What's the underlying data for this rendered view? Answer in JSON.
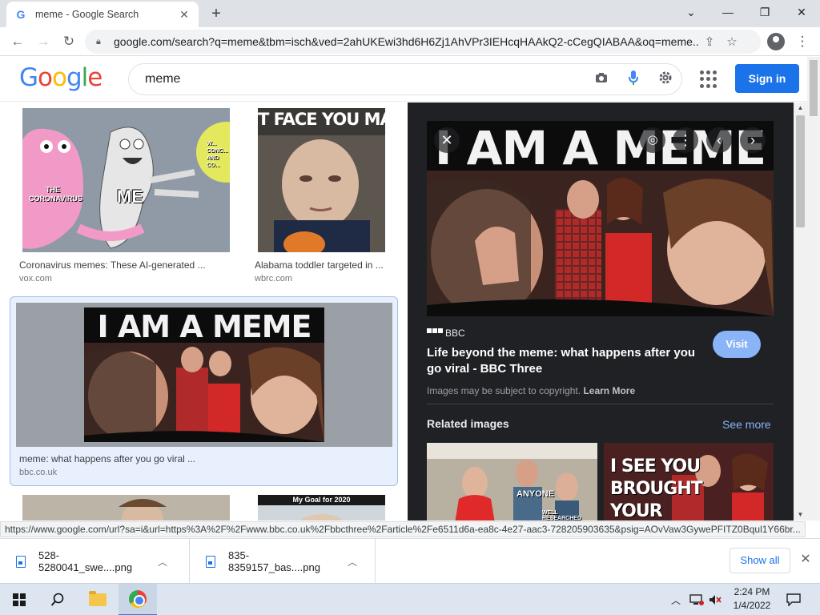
{
  "browser": {
    "tab_title": "meme - Google Search",
    "tab_favicon": "G",
    "url": "google.com/search?q=meme&tbm=isch&ved=2ahUKEwi3hd6H6Zj1AhVPr3IEHcqHAAkQ2-cCegQIABAA&oq=meme...",
    "status_url": "https://www.google.com/url?sa=i&url=https%3A%2F%2Fwww.bbc.co.uk%2Fbbcthree%2Farticle%2Fe6511d6a-ea8c-4e27-aac3-728205903635&psig=AOvVaw3GywePFITZ0Bqul1Y66br..."
  },
  "google": {
    "logo_letters": [
      "G",
      "o",
      "o",
      "g",
      "l",
      "e"
    ],
    "query": "meme",
    "signin_label": "Sign in"
  },
  "results": [
    {
      "caption": "Coronavirus memes: These AI-generated ...",
      "source": "vox.com",
      "img_labels": [
        "THE CORONAVIRUS",
        "ME",
        "W... CONC... AND CO..."
      ]
    },
    {
      "caption": "Alabama toddler targeted in ...",
      "source": "wbrc.com",
      "img_labels": [
        "T FACE YOU MAKI"
      ]
    },
    {
      "caption": "meme: what happens after you go viral ...",
      "source": "bbc.co.uk",
      "img_labels": [
        "I AM A MEME"
      ]
    },
    {
      "caption": "",
      "source": "",
      "img_labels": []
    },
    {
      "caption": "",
      "source": "",
      "img_labels": [
        "My Goal for 2020"
      ]
    }
  ],
  "preview": {
    "image_text": "I AM A MEME",
    "site": "BBC",
    "title": "Life beyond the meme: what happens after you go viral - BBC Three",
    "visit_label": "Visit",
    "copyright": "Images may be subject to copyright.",
    "learn_more": "Learn More",
    "related_heading": "Related images",
    "see_more": "See more",
    "related": [
      {
        "text": "ANYONE",
        "subtext": "WELL RESEARCHED"
      },
      {
        "text": "I SEE YOU BROUGHT YOUR OTTER..."
      }
    ]
  },
  "downloads": [
    {
      "name": "528-5280041_swe....png"
    },
    {
      "name": "835-8359157_bas....png"
    }
  ],
  "download_show_all": "Show all",
  "taskbar": {
    "time": "2:24 PM",
    "date": "1/4/2022"
  },
  "icons": {
    "tab_close": "close-icon",
    "new_tab": "plus-icon",
    "back": "arrow-left-icon",
    "forward": "arrow-right-icon",
    "reload": "reload-icon",
    "lock": "lock-icon",
    "share": "share-icon",
    "bookmark": "star-icon",
    "camera": "camera-icon",
    "mic": "microphone-icon",
    "settings": "gear-icon",
    "apps": "apps-grid-icon"
  },
  "colors": {
    "accent": "#1a73e8",
    "panel_bg": "#202124",
    "visit_button": "#8ab4f8"
  }
}
